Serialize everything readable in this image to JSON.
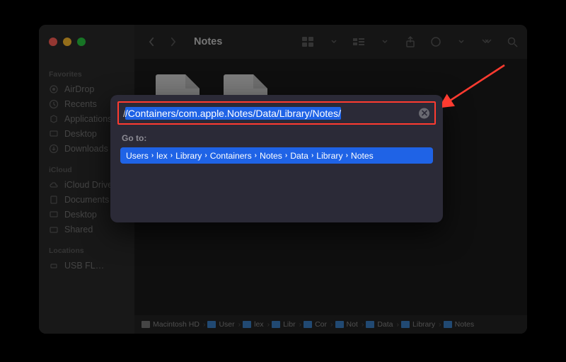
{
  "window": {
    "title": "Notes"
  },
  "sidebar": {
    "sections": [
      {
        "label": "Favorites",
        "items": [
          {
            "label": "AirDrop",
            "icon": "airdrop"
          },
          {
            "label": "Recents",
            "icon": "clock"
          },
          {
            "label": "Applications",
            "icon": "apps"
          },
          {
            "label": "Desktop",
            "icon": "desktop"
          },
          {
            "label": "Downloads",
            "icon": "downloads"
          }
        ]
      },
      {
        "label": "iCloud",
        "items": [
          {
            "label": "iCloud Drive",
            "icon": "cloud"
          },
          {
            "label": "Documents",
            "icon": "documents"
          },
          {
            "label": "Desktop",
            "icon": "desktop"
          },
          {
            "label": "Shared",
            "icon": "shared"
          }
        ]
      },
      {
        "label": "Locations",
        "items": [
          {
            "label": "USB FL…",
            "icon": "usb"
          }
        ]
      }
    ]
  },
  "goto": {
    "prefix": "/",
    "value": "/Containers/com.apple.Notes/Data/Library/Notes/",
    "label": "Go to:",
    "suggestion_segments": [
      "Users",
      "lex",
      "Library",
      "Containers",
      "Notes",
      "Data",
      "Library",
      "Notes"
    ]
  },
  "pathbar": {
    "root": "Macintosh HD",
    "segments": [
      "User",
      "lex",
      "Libr",
      "Cor",
      "Not",
      "Data",
      "Library",
      "Notes"
    ]
  }
}
